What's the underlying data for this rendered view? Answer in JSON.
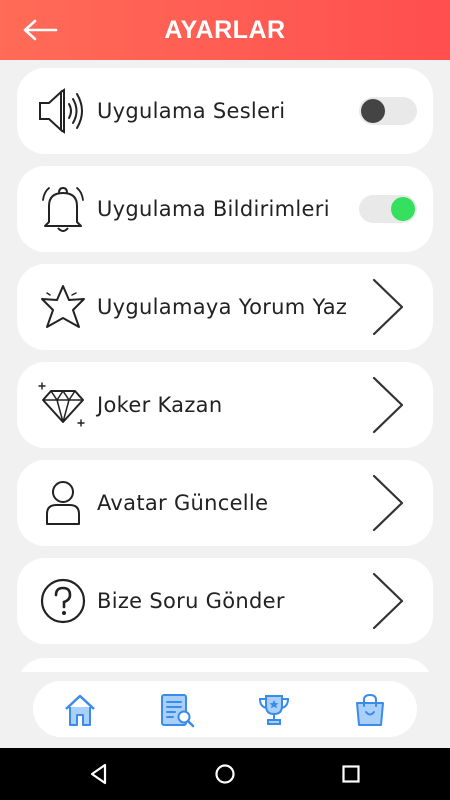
{
  "header": {
    "title": "AYARLAR",
    "back_icon": "arrow-left-icon"
  },
  "settings": {
    "items": [
      {
        "label": "Uygulama Sesleri",
        "icon": "speaker-icon",
        "control": "toggle",
        "enabled": false
      },
      {
        "label": "Uygulama Bildirimleri",
        "icon": "bell-icon",
        "control": "toggle",
        "enabled": true
      },
      {
        "label": "Uygulamaya Yorum Yaz",
        "icon": "star-icon",
        "control": "chevron"
      },
      {
        "label": "Joker Kazan",
        "icon": "diamond-icon",
        "control": "chevron"
      },
      {
        "label": "Avatar Güncelle",
        "icon": "user-icon",
        "control": "chevron"
      },
      {
        "label": "Bize Soru Gönder",
        "icon": "question-icon",
        "control": "chevron"
      }
    ]
  },
  "bottom_nav": {
    "items": [
      {
        "icon": "home-icon"
      },
      {
        "icon": "search-list-icon"
      },
      {
        "icon": "trophy-icon"
      },
      {
        "icon": "shopping-bag-icon"
      }
    ]
  },
  "colors": {
    "header_start": "#ff6b57",
    "header_end": "#ff4f4f",
    "toggle_on": "#34e05e",
    "toggle_off_knob": "#444444",
    "nav_icon": "#3b8bea"
  }
}
